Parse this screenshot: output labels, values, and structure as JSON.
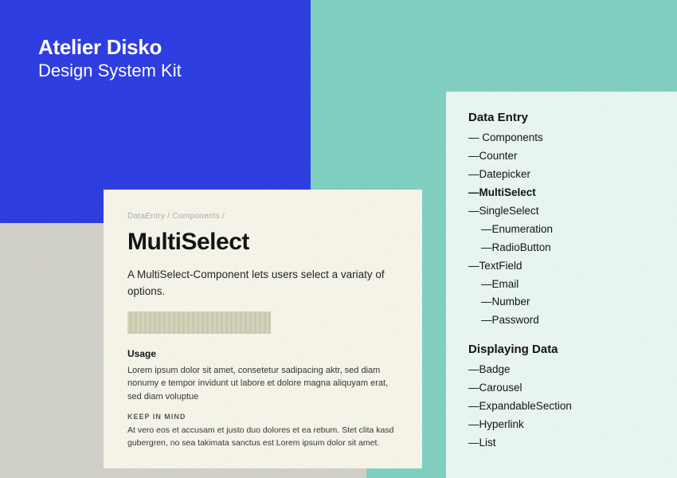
{
  "header": {
    "title": "Atelier Disko",
    "subtitle": "Design System Kit"
  },
  "doc": {
    "breadcrumb": "DataEntry / Components /",
    "title": "MultiSelect",
    "description": "A MultiSelect-Component lets users select a variaty of options.",
    "usage_title": "Usage",
    "usage_text": "Lorem ipsum dolor sit amet, consetetur sadipacing aktr, sed diam nonumy e tempor invidunt ut labore et dolore magna aliquyam erat, sed diam voluptue",
    "keep_label": "KEEP IN MIND",
    "keep_text": "At vero eos et accusam et justo duo dolores et ea rebum. Stet clita kasd gubergren, no sea takimata sanctus est Lorem ipsum dolor sit amet."
  },
  "nav": {
    "sections": [
      {
        "title": "Data Entry",
        "items": [
          {
            "label": "— Components",
            "level": "level-1"
          },
          {
            "label": "—Counter",
            "level": "level-2"
          },
          {
            "label": "—Datepicker",
            "level": "level-2"
          },
          {
            "label": "—MultiSelect",
            "level": "level-2",
            "active": true
          },
          {
            "label": "—SingleSelect",
            "level": "level-2"
          },
          {
            "label": "—Enumeration",
            "level": "level-3"
          },
          {
            "label": "—RadioButton",
            "level": "level-3"
          },
          {
            "label": "—TextField",
            "level": "level-2"
          },
          {
            "label": "—Email",
            "level": "level-3"
          },
          {
            "label": "—Number",
            "level": "level-3"
          },
          {
            "label": "—Password",
            "level": "level-3"
          }
        ]
      },
      {
        "title": "Displaying Data",
        "items": [
          {
            "label": "—Badge",
            "level": "level-2"
          },
          {
            "label": "—Carousel",
            "level": "level-2"
          },
          {
            "label": "—ExpandableSection",
            "level": "level-2"
          },
          {
            "label": "—Hyperlink",
            "level": "level-2"
          },
          {
            "label": "—List",
            "level": "level-2"
          }
        ]
      }
    ]
  }
}
